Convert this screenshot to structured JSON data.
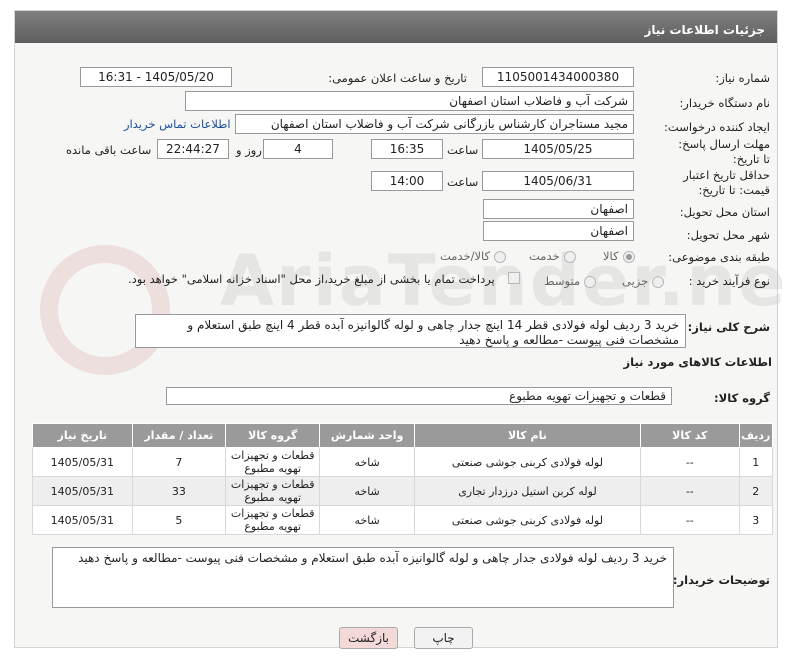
{
  "header": {
    "title": "جزئیات اطلاعات نیاز"
  },
  "need_number": {
    "label": "شماره نیاز:",
    "value": "1105001434000380"
  },
  "announce": {
    "label": "تاریخ و ساعت اعلان عمومی:",
    "value": "1405/05/20 - 16:31"
  },
  "buyer_org": {
    "label": "نام دستگاه خریدار:",
    "value": "شرکت آب و فاضلاب استان اصفهان"
  },
  "creator": {
    "label": "ایجاد کننده درخواست:",
    "value": "مجید مستاجران کارشناس بازرگانی شرکت آب و فاضلاب استان اصفهان",
    "contact_link": "اطلاعات تماس خریدار"
  },
  "deadline": {
    "label": "مهلت ارسال پاسخ: تا تاریخ:",
    "date": "1405/05/25",
    "time_label": "ساعت",
    "time": "16:35",
    "days": "4",
    "days_label": "روز و",
    "remaining": "22:44:27",
    "remaining_label": "ساعت باقی مانده"
  },
  "validity": {
    "label": "حداقل تاریخ اعتبار قیمت: تا تاریخ:",
    "date": "1405/06/31",
    "time_label": "ساعت",
    "time": "14:00"
  },
  "province": {
    "label": "استان محل تحویل:",
    "value": "اصفهان"
  },
  "city": {
    "label": "شهر محل تحویل:",
    "value": "اصفهان"
  },
  "category": {
    "label": "طبقه بندی موضوعی:",
    "options": [
      "کالا",
      "خدمت",
      "کالا/خدمت"
    ],
    "selected": "کالا"
  },
  "process": {
    "label": "نوع فرآیند خرید :",
    "options": [
      "جزیی",
      "متوسط"
    ],
    "selected": "جزیی",
    "payment_note": "پرداخت تمام یا بخشی از مبلغ خرید،از محل \"اسناد خزانه اسلامی\" خواهد بود."
  },
  "description": {
    "label": "شرح کلی نیاز:",
    "value": "خرید 3 ردیف لوله فولادی قطر 14 اینچ جدار چاهی و لوله گالوانیزه آبده  قطر 4 اینچ طبق استعلام و مشخصات فنی پیوست -مطالعه و پاسخ دهید"
  },
  "goods_info_title": "اطلاعات کالاهای مورد نیاز",
  "goods_group": {
    "label": "گروه کالا:",
    "value": "قطعات و تجهیزات تهویه مطبوع"
  },
  "table": {
    "headers": [
      "ردیف",
      "کد کالا",
      "نام کالا",
      "واحد شمارش",
      "گروه کالا",
      "تعداد / مقدار",
      "تاریخ نیاز"
    ],
    "rows": [
      {
        "index": "1",
        "code": "--",
        "name": "لوله فولادی کربنی جوشی صنعتی",
        "unit": "شاخه",
        "group": "قطعات و تجهیزات تهویه مطبوع",
        "qty": "7",
        "date": "1405/05/31"
      },
      {
        "index": "2",
        "code": "--",
        "name": "لوله کربن استیل درزدار تجاری",
        "unit": "شاخه",
        "group": "قطعات و تجهیزات تهویه مطبوع",
        "qty": "33",
        "date": "1405/05/31"
      },
      {
        "index": "3",
        "code": "--",
        "name": "لوله فولادی کربنی جوشی صنعتی",
        "unit": "شاخه",
        "group": "قطعات و تجهیزات تهویه مطبوع",
        "qty": "5",
        "date": "1405/05/31"
      }
    ]
  },
  "buyer_notes": {
    "label": "توضیحات خریدار:",
    "value": "خرید 3 ردیف لوله فولادی جدار چاهی و لوله گالوانیزه آبده طبق استعلام و مشخصات فنی پیوست -مطالعه و پاسخ دهید"
  },
  "buttons": {
    "print": "چاپ",
    "back": "بازگشت"
  },
  "watermark": "AriaTender.neT",
  "colors": {
    "header": "#6e6e6e",
    "link": "#1a4f9c",
    "back_button": "#f4d9d9"
  }
}
